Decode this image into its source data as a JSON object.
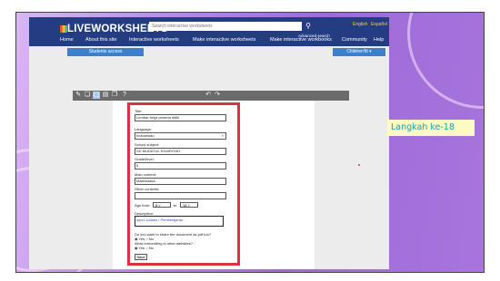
{
  "site": {
    "logo": "LIVEWORKSHEETS",
    "search_placeholder": "Search interactive worksheets",
    "advanced_search": "Advanced search",
    "languages": [
      "English",
      "Español"
    ],
    "nav": [
      "Home",
      "About this site",
      "Interactive worksheets",
      "Make interactive worksheets",
      "Make interactive workbooks",
      "Community",
      "Help"
    ],
    "students_access": "Students access",
    "children_button": "Children'fit ▾"
  },
  "editor": {
    "toolbar_icons": [
      "edit-icon",
      "copy-icon",
      "page-icon",
      "doc-icon",
      "copy2-icon",
      "help-icon",
      "undo-icon",
      "redo-icon"
    ]
  },
  "form": {
    "title_label": "Title:",
    "title_value": "Lembar kerja peserta didik",
    "language_label": "Language:",
    "language_value": "Indonesian",
    "school_label": "School subject:",
    "school_value": "SD MUDATUL KHAIRIYAH",
    "grade_label": "Grade/level:",
    "grade_value": "5",
    "main_label": "Main content:",
    "main_value": "Matematika",
    "other_label": "Other contents:",
    "other_value": "",
    "age_label": "Age from:",
    "age_from": "8",
    "age_to_label": "to",
    "age_to": "18",
    "desc_label": "Description:",
    "desc_value": "lpps1 kuliahs / Pembelajaran",
    "share_question": "Do you want to share the document as pdf too?",
    "share_yes": "Yes",
    "share_no": "No",
    "embed_question": "Allow embedding in other websites?",
    "embed_yes": "Yes",
    "embed_no": "No",
    "save_label": "Save"
  },
  "overlay": {
    "step_label": "Langkah ke-18"
  },
  "colors": {
    "header": "#243d82",
    "accent_button": "#3f7fc8",
    "highlight_border": "#d6343e",
    "step_bg": "#fff9c2",
    "step_text": "#16a0b5"
  }
}
